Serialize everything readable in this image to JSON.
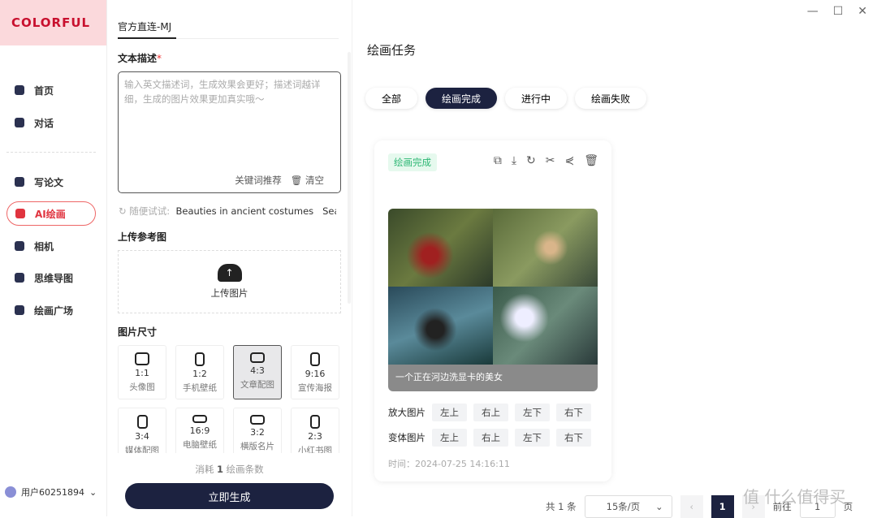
{
  "brand": "COLORFUL",
  "sidebar": {
    "items": [
      {
        "label": "首页",
        "icon": "chat-bubble-icon"
      },
      {
        "label": "对话",
        "icon": "robot-icon"
      },
      {
        "label": "写论文",
        "icon": "document-icon"
      },
      {
        "label": "AI绘画",
        "icon": "image-icon",
        "active": true
      },
      {
        "label": "相机",
        "icon": "camera-icon"
      },
      {
        "label": "思维导图",
        "icon": "pen-icon"
      },
      {
        "label": "绘画广场",
        "icon": "gallery-icon"
      }
    ],
    "user": "用户60251894"
  },
  "form": {
    "tab": "官方直连-MJ",
    "desc_label": "文本描述",
    "required_mark": "*",
    "placeholder": "输入英文描述词，生成效果会更好；描述词越详细，生成的图片效果更加真实哦～",
    "keyword_btn": "关键词推荐",
    "clear_btn": "清空",
    "try_label": "随便试试:",
    "try_items": [
      "Beauties in ancient costumes",
      "Seaside"
    ],
    "upload_label": "上传参考图",
    "upload_btn": "上传图片",
    "size_label": "图片尺寸",
    "sizes": [
      {
        "ratio": "1:1",
        "name": "头像图"
      },
      {
        "ratio": "1:2",
        "name": "手机壁纸"
      },
      {
        "ratio": "4:3",
        "name": "文章配图",
        "selected": true
      },
      {
        "ratio": "9:16",
        "name": "宣传海报"
      },
      {
        "ratio": "3:4",
        "name": "媒体配图"
      },
      {
        "ratio": "16:9",
        "name": "电脑壁纸"
      },
      {
        "ratio": "3:2",
        "name": "横版名片"
      },
      {
        "ratio": "2:3",
        "name": "小红书图"
      }
    ],
    "cost_pre": "消耗",
    "cost_num": "1",
    "cost_post": "绘画条数",
    "generate": "立即生成"
  },
  "main": {
    "title": "绘画任务",
    "filters": [
      "全部",
      "绘画完成",
      "进行中",
      "绘画失败"
    ],
    "active_filter": "绘画完成",
    "card": {
      "status": "绘画完成",
      "caption": "一个正在河边洗显卡的美女",
      "upscale_label": "放大图片",
      "variant_label": "变体图片",
      "positions": [
        "左上",
        "右上",
        "左下",
        "右下"
      ],
      "time": "时间：2024-07-25 14:16:11",
      "actions": [
        "copy-icon",
        "download-icon",
        "refresh-icon",
        "scissors-icon",
        "share-icon",
        "trash-icon"
      ]
    },
    "pager": {
      "total": "共 1 条",
      "per_page": "15条/页",
      "current": "1",
      "goto": "前往",
      "goto_value": "1",
      "page_suffix": "页"
    }
  },
  "watermark": "值 什么值得买",
  "colors": {
    "accent": "#1c2240",
    "brand": "#c8102e",
    "active_nav": "#e0343f",
    "success": "#2bb673"
  }
}
